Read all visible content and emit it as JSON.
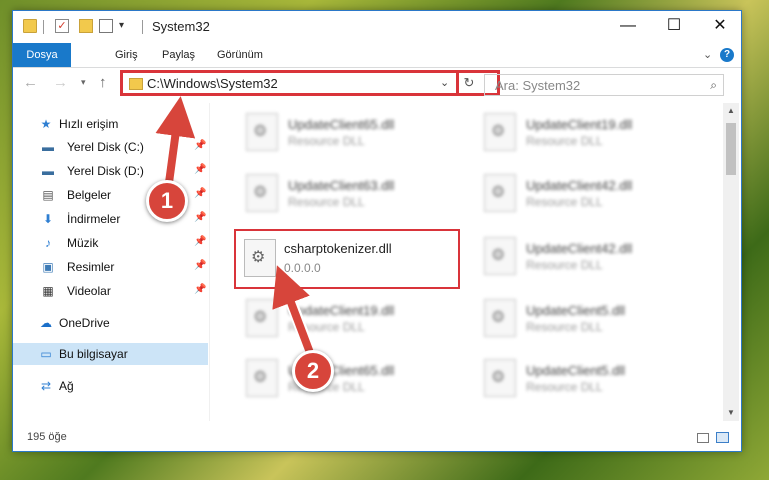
{
  "window": {
    "title": "System32",
    "minimize": "—",
    "maximize": "☐",
    "close": "✕"
  },
  "quick_access_toolbar": {
    "check_glyph": "✓",
    "dropdown": "▾"
  },
  "ribbon": {
    "tabs": [
      "Dosya",
      "Giriş",
      "Paylaş",
      "Görünüm"
    ],
    "expand": "⌄",
    "help": "?"
  },
  "nav": {
    "back": "←",
    "forward": "→",
    "recent": "▾",
    "up": "↑",
    "address": "C:\\Windows\\System32",
    "address_dropdown": "⌄",
    "refresh": "↻",
    "search_placeholder": "Ara: System32",
    "search_icon": "⌕"
  },
  "sidebar": {
    "items": [
      {
        "label": "Hızlı erişim",
        "icon": "★",
        "pinned": false
      },
      {
        "label": "Yerel Disk (C:)",
        "icon": "▬",
        "pinned": true
      },
      {
        "label": "Yerel Disk (D:)",
        "icon": "▬",
        "pinned": true
      },
      {
        "label": "Belgeler",
        "icon": "▤",
        "pinned": true
      },
      {
        "label": "İndirmeler",
        "icon": "⬇",
        "pinned": true
      },
      {
        "label": "Müzik",
        "icon": "♪",
        "pinned": true
      },
      {
        "label": "Resimler",
        "icon": "▣",
        "pinned": true
      },
      {
        "label": "Videolar",
        "icon": "▦",
        "pinned": true
      },
      {
        "label": "OneDrive",
        "icon": "☁",
        "pinned": false
      },
      {
        "label": "Bu bilgisayar",
        "icon": "▭",
        "pinned": false,
        "selected": true
      },
      {
        "label": "Ağ",
        "icon": "⇄",
        "pinned": false
      }
    ],
    "pin_glyph": "📌"
  },
  "files": {
    "left": [
      {
        "name": "UpdateClient65.dll",
        "desc": "Resource DLL"
      },
      {
        "name": "UpdateClient63.dll",
        "desc": "Resource DLL"
      },
      {
        "name": "csharptokenizer.dll",
        "desc": "0.0.0.0"
      },
      {
        "name": "UpdateClient19.dll",
        "desc": "Resource DLL"
      },
      {
        "name": "UpdateClient65.dll",
        "desc": "Resource DLL"
      }
    ],
    "right": [
      {
        "name": "UpdateClient19.dll",
        "desc": "Resource DLL"
      },
      {
        "name": "UpdateClient42.dll",
        "desc": "Resource DLL"
      },
      {
        "name": "UpdateClient42.dll",
        "desc": "Resource DLL"
      },
      {
        "name": "UpdateClient5.dll",
        "desc": "Resource DLL"
      },
      {
        "name": "UpdateClient5.dll",
        "desc": "Resource DLL"
      }
    ],
    "gear_glyph": "⚙"
  },
  "status": {
    "count": "195 öğe"
  },
  "annotations": {
    "step1": "1",
    "step2": "2"
  },
  "colors": {
    "accent": "#1979ca",
    "highlight": "#d9343a",
    "selected_bg": "#cce4f7"
  }
}
